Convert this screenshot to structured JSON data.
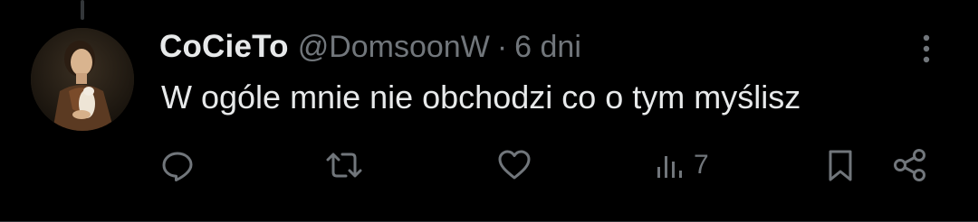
{
  "tweet": {
    "display_name": "CoCieTo",
    "handle": "@DomsoonW",
    "separator": "·",
    "timestamp": "6 dni",
    "text": "W ogóle mnie nie obchodzi co o tym myślisz",
    "avatar_description": "profile avatar"
  },
  "actions": {
    "reply": {
      "icon": "reply-icon"
    },
    "retweet": {
      "icon": "retweet-icon"
    },
    "like": {
      "icon": "heart-icon"
    },
    "views": {
      "icon": "views-icon",
      "count": "7"
    },
    "bookmark": {
      "icon": "bookmark-icon"
    },
    "share": {
      "icon": "share-icon"
    }
  },
  "colors": {
    "background": "#000000",
    "primary_text": "#e7e9ea",
    "secondary_text": "#71767b",
    "divider": "#2f3336"
  }
}
